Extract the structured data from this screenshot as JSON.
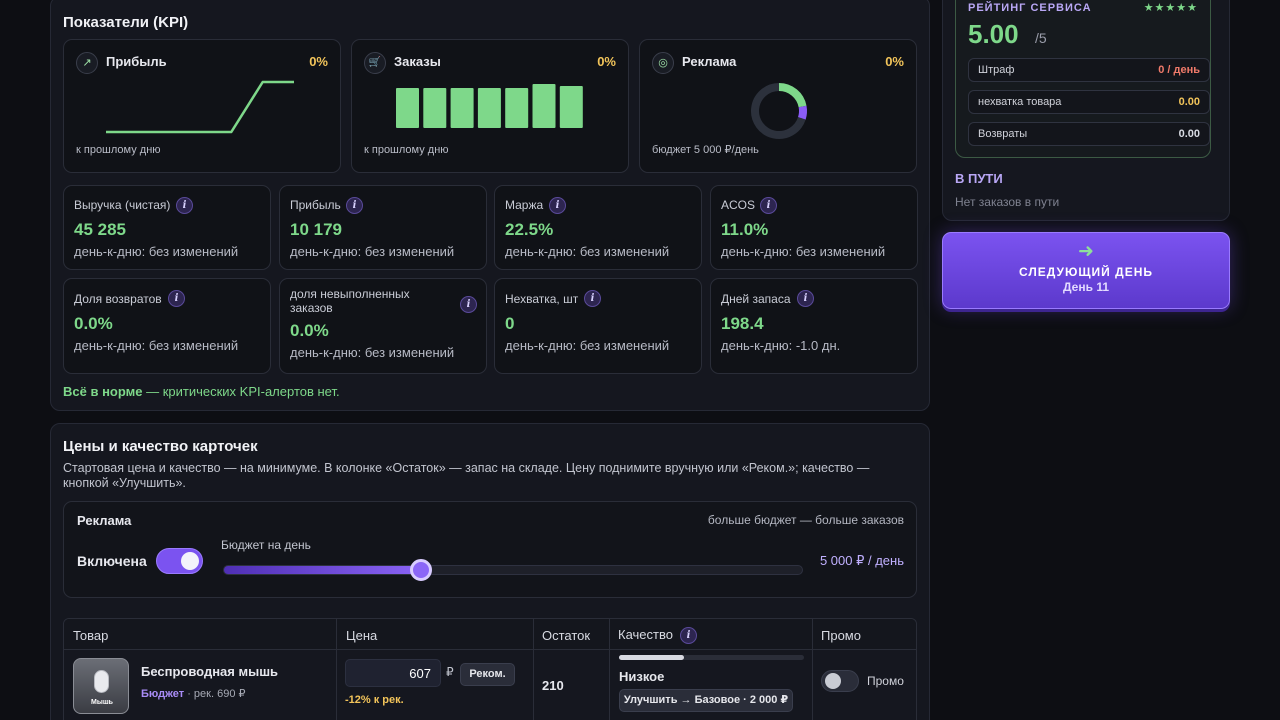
{
  "kpi": {
    "title": "Показатели (KPI)",
    "top_cards": [
      {
        "icon": "trend-up-icon",
        "glyph": "↗",
        "title": "Прибыль",
        "pct": "0%",
        "foot": "к прошлому дню"
      },
      {
        "icon": "cart-icon",
        "glyph": "🛒",
        "title": "Заказы",
        "pct": "0%",
        "foot": "к прошлому дню"
      },
      {
        "icon": "target-icon",
        "glyph": "◎",
        "title": "Реклама",
        "pct": "0%",
        "foot": "бюджет 5 000 ₽/день"
      }
    ],
    "metrics": [
      {
        "label": "Выручка (чистая)",
        "value": "45 285",
        "sub": "день-к-дню: без изменений"
      },
      {
        "label": "Прибыль",
        "value": "10 179",
        "sub": "день-к-дню: без изменений"
      },
      {
        "label": "Маржа",
        "value": "22.5%",
        "sub": "день-к-дню: без изменений"
      },
      {
        "label": "ACOS",
        "value": "11.0%",
        "sub": "день-к-дню: без изменений"
      },
      {
        "label": "Доля возвратов",
        "value": "0.0%",
        "sub": "день-к-дню: без изменений"
      },
      {
        "label": "доля невыполненных заказов",
        "value": "0.0%",
        "sub": "день-к-дню: без изменений"
      },
      {
        "label": "Нехватка, шт",
        "value": "0",
        "sub": "день-к-дню: без изменений"
      },
      {
        "label": "Дней запаса",
        "value": "198.4",
        "sub": "день-к-дню: -1.0 дн."
      }
    ],
    "info_glyph": "i",
    "alert_bold": "Всё в норме",
    "alert_rest": " — критических KPI-алертов нет."
  },
  "rating": {
    "title": "РЕЙТИНГ СЕРВИСА",
    "stars": "★★★★★",
    "value": "5.00",
    "max": "/5",
    "rows": [
      {
        "label": "Штраф",
        "value": "0 / день",
        "color": "#f07a6a"
      },
      {
        "label": "нехватка товара",
        "value": "0.00",
        "color": "#f2c45a"
      },
      {
        "label": "Возвраты",
        "value": "0.00",
        "color": "#d9dce4"
      }
    ]
  },
  "transit": {
    "title": "В ПУТИ",
    "empty": "Нет заказов в пути"
  },
  "next_day": {
    "arrow": "➜",
    "label": "СЛЕДУЮЩИЙ ДЕНЬ",
    "day": "День 11"
  },
  "prices": {
    "title": "Цены и качество карточек",
    "desc": "Стартовая цена и качество — на минимуме. В колонке «Остаток» — запас на складе. Цену поднимите вручную или «Реком.»; качество — кнопкой «Улучшить».",
    "ads": {
      "title": "Реклама",
      "hint": "больше бюджет — больше заказов",
      "enabled_label": "Включена",
      "enabled": true,
      "budget_label": "Бюджет на день",
      "budget_value": "5 000 ₽ / день",
      "slider_fraction": 0.34
    },
    "table": {
      "headers": [
        "Товар",
        "Цена",
        "Остаток",
        "Качество",
        "Промо"
      ],
      "rows": [
        {
          "thumb_label": "Мышь",
          "name": "Беспроводная мышь",
          "segment": "Бюджет",
          "rec": " · рек. 690 ₽",
          "price": "607",
          "currency": "₽",
          "rec_button": "Реком.",
          "price_note": "-12% к рек.",
          "stock": "210",
          "quality_fraction": 0.35,
          "quality_label": "Низкое",
          "upgrade_button": "Улучшить → Базовое · 2 000 ₽",
          "promo_label": "Промо",
          "promo_on": false
        }
      ]
    }
  },
  "chart_data": [
    {
      "type": "line",
      "title": "Прибыль",
      "values": [
        0,
        0,
        0,
        0,
        0,
        1,
        1
      ],
      "note": "sparkline"
    },
    {
      "type": "bar",
      "title": "Заказы",
      "values": [
        1,
        1,
        1,
        1,
        1,
        1.1,
        1.05
      ],
      "note": "sparkbar"
    },
    {
      "type": "pie",
      "title": "Реклама",
      "slices": [
        {
          "name": "spent",
          "value": 22,
          "color": "#7ed88a"
        },
        {
          "name": "ads",
          "value": 8,
          "color": "#8b5cf6"
        },
        {
          "name": "rest",
          "value": 70,
          "color": "#2c313c"
        }
      ]
    }
  ]
}
